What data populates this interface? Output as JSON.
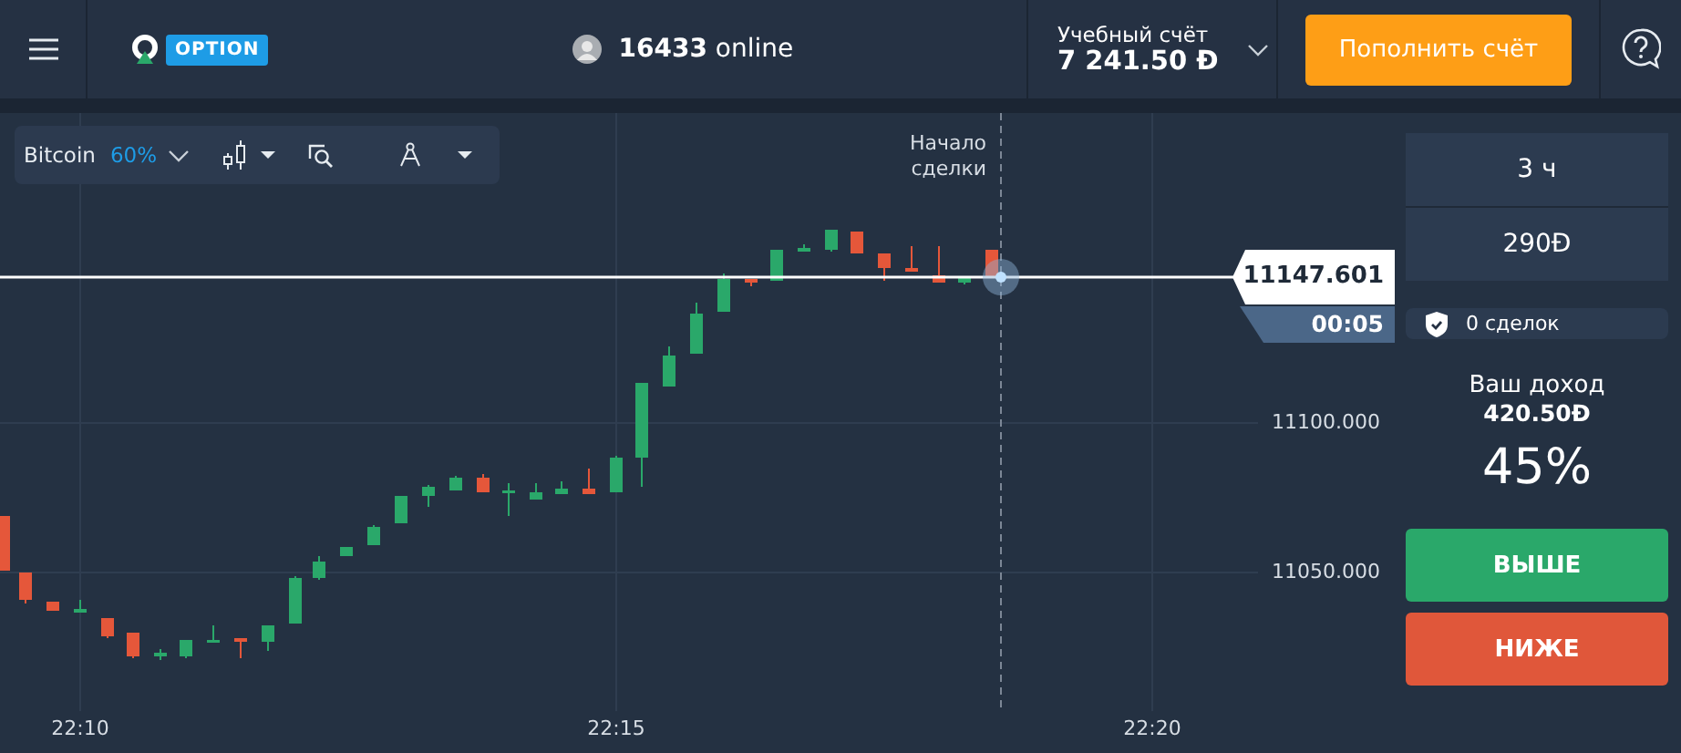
{
  "header": {
    "logo_badge": "OPTION",
    "online_count": "16433",
    "online_label": "online",
    "account": {
      "label": "Учебный счёт",
      "balance": "7 241.50 Đ"
    },
    "deposit_button": "Пополнить счёт"
  },
  "toolbar": {
    "asset": "Bitcoin",
    "payout": "60%"
  },
  "chart": {
    "trade_start_label": "Начало\nсделки",
    "price": "11147.601",
    "timer": "00:05",
    "y_labels": [
      "11100.000",
      "11050.000"
    ],
    "x_labels": [
      "22:10",
      "22:15",
      "22:20"
    ]
  },
  "panel": {
    "duration": "3 ч",
    "amount": "290Đ",
    "trades": "0 сделок",
    "income_label": "Ваш доход",
    "income": "420.50Đ",
    "percent": "45%",
    "buttons": [
      {
        "label": "ВЫШЕ",
        "kind": "up"
      },
      {
        "label": "НИЖЕ",
        "kind": "down"
      }
    ]
  }
}
